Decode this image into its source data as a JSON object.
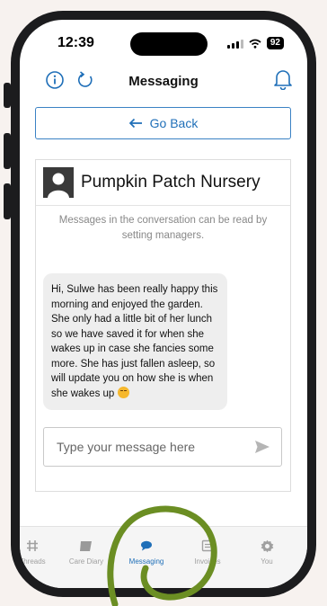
{
  "status": {
    "time": "12:39",
    "battery": "92"
  },
  "header": {
    "title": "Messaging"
  },
  "go_back": {
    "label": "Go Back"
  },
  "conversation": {
    "name": "Pumpkin Patch Nursery",
    "notice": "Messages in the conversation can be read by setting managers.",
    "message": "Hi, Sulwe has been really happy this morning and enjoyed the garden. She only had a little bit of her lunch so we have saved it for when she wakes up in case she fancies some more. She has just fallen asleep, so will update you on how she is when she wakes up"
  },
  "composer": {
    "placeholder": "Type your message here"
  },
  "tabs": [
    {
      "label": "Threads",
      "icon": "threads-icon"
    },
    {
      "label": "Care Diary",
      "icon": "care-diary-icon"
    },
    {
      "label": "Messaging",
      "icon": "messaging-icon"
    },
    {
      "label": "Invoices",
      "icon": "invoices-icon"
    },
    {
      "label": "You",
      "icon": "settings-gear-icon"
    }
  ],
  "colors": {
    "accent": "#1f6fb8",
    "highlight_circle": "#6b8e23"
  }
}
